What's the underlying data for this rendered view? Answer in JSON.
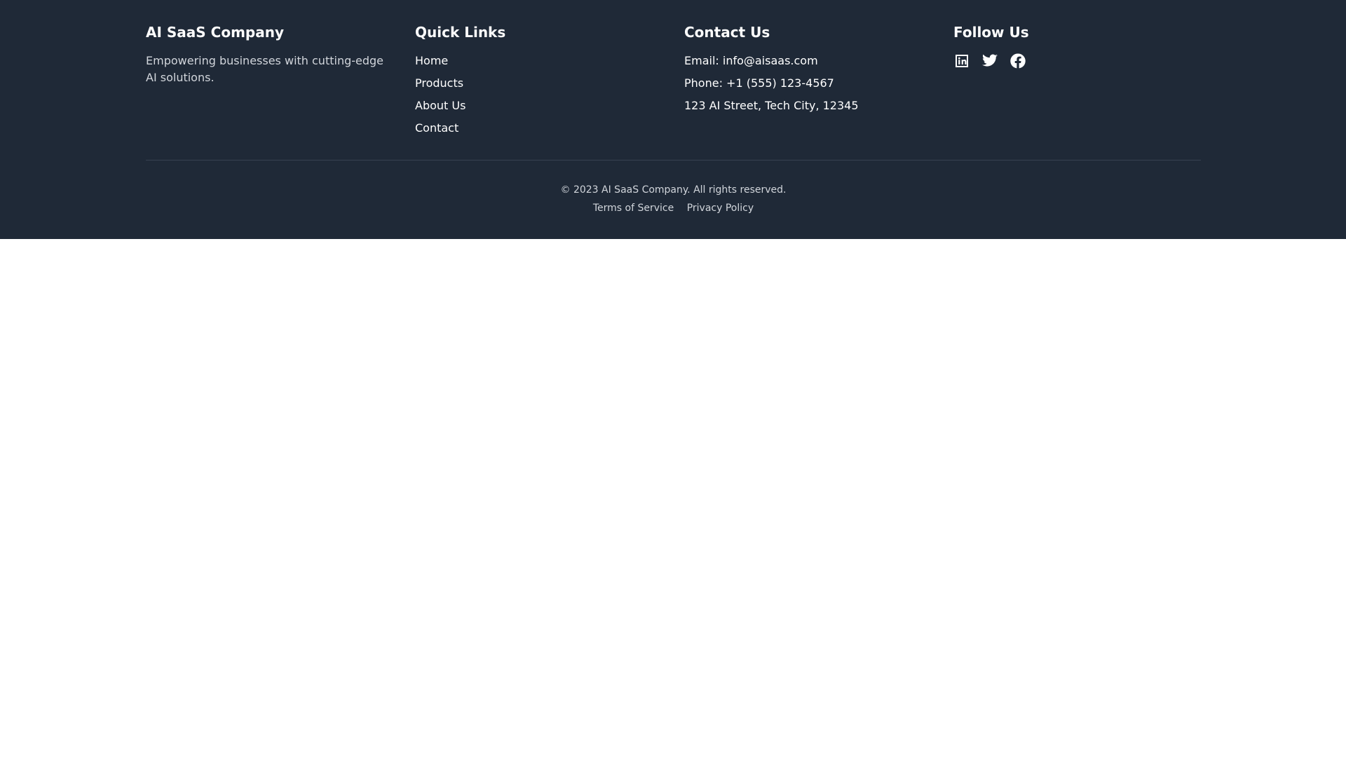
{
  "brand": {
    "name": "AI SaaS Company",
    "tagline": "Empowering businesses with cutting-edge AI solutions."
  },
  "quick_links": {
    "heading": "Quick Links",
    "items": [
      "Home",
      "Products",
      "About Us",
      "Contact"
    ]
  },
  "contact": {
    "heading": "Contact Us",
    "email": "Email: info@aisaas.com",
    "phone": "Phone: +1 (555) 123-4567",
    "address": "123 AI Street, Tech City, 12345"
  },
  "follow": {
    "heading": "Follow Us",
    "icons": [
      "linkedin-icon",
      "twitter-icon",
      "facebook-icon"
    ]
  },
  "bottom": {
    "copyright": "© 2023 AI SaaS Company. All rights reserved.",
    "terms": "Terms of Service",
    "privacy": "Privacy Policy"
  },
  "colors": {
    "footer_bg": "#1f2937",
    "text": "#ffffff",
    "muted_text": "#d1d5db",
    "divider": "#374151"
  }
}
